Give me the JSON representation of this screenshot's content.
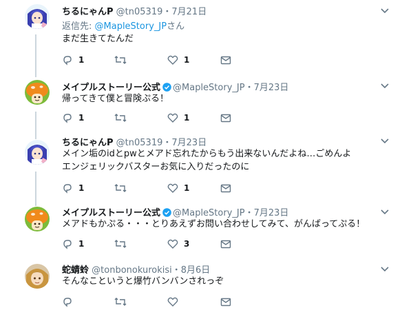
{
  "tweets": [
    {
      "name": "ちるにゃんP",
      "handle": "@tn05319",
      "sep": "・",
      "date": "7月21日",
      "replying_prefix": "返信先: ",
      "replying_to": "@MapleStory_JP",
      "replying_suffix": "さん",
      "lines": [
        "まだ生きてたんだ"
      ],
      "reply_count": "1",
      "retweet_count": "",
      "like_count": "1",
      "avatar": "anime-girl-avatar"
    },
    {
      "name": "メイプルストーリー公式",
      "handle": "@MapleStory_JP",
      "sep": "・",
      "date": "7月23日",
      "lines": [
        "帰ってきて僕と冒険ぷる！"
      ],
      "reply_count": "1",
      "retweet_count": "",
      "like_count": "1",
      "avatar": "mushroom-avatar"
    },
    {
      "name": "ちるにゃんP",
      "handle": "@tn05319",
      "sep": "・",
      "date": "7月23日",
      "lines": [
        "メイン垢のidとpwとメアド忘れたからもう出来ないんだよね…ごめんよ",
        "エンジェリックバスターお気に入りだったのに"
      ],
      "reply_count": "1",
      "retweet_count": "",
      "like_count": "1",
      "avatar": "anime-girl-avatar"
    },
    {
      "name": "メイプルストーリー公式",
      "handle": "@MapleStory_JP",
      "sep": "・",
      "date": "7月23日",
      "lines": [
        "メアドもかぷる・・・とりあえずお問い合わせしてみて、がんばってぷる！"
      ],
      "reply_count": "1",
      "retweet_count": "",
      "like_count": "3",
      "avatar": "mushroom-avatar"
    },
    {
      "name": "蛇蜻蛉",
      "handle": "@tonbonokurokisi",
      "sep": "・",
      "date": "8月6日",
      "lines": [
        "そんなこというと爆竹バンバンされっぞ"
      ],
      "reply_count": "",
      "retweet_count": "",
      "like_count": "",
      "avatar": "blonde-girl-avatar"
    }
  ],
  "colors": {
    "text": "#14171a",
    "secondary": "#657786",
    "link": "#1b95e0",
    "verified": "#1da1f2",
    "thread_line": "#ccd6dd"
  }
}
